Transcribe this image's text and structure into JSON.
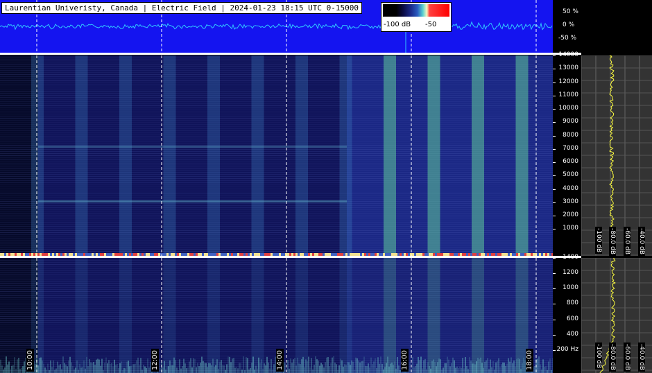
{
  "header": {
    "title": "Laurentian Univeristy, Canada | Electric Field | 2024-01-23 18:15 UTC 0-15000"
  },
  "colorbar": {
    "min_label": "-100 dB",
    "max_label": "-50"
  },
  "waveform_scale": {
    "top": "50 %",
    "mid": "0 %",
    "bottom": "-50 %"
  },
  "upper_freq_axis": {
    "ticks": [
      "14000",
      "13000",
      "12000",
      "11000",
      "10000",
      "9000",
      "8000",
      "7000",
      "6000",
      "5000",
      "4000",
      "3000",
      "2000",
      "1000"
    ]
  },
  "lower_freq_axis": {
    "ticks": [
      "1400",
      "1200",
      "1000",
      "800",
      "600",
      "400",
      "200 Hz"
    ]
  },
  "side_db_labels": [
    "-100 dB",
    "-80.0 dB",
    "-60.0 dB",
    "-40.0 dB"
  ],
  "time_labels": [
    "10:00",
    "12:00",
    "14:00",
    "16:00",
    "18:00"
  ],
  "colors": {
    "waveform_bg": "#1414f0",
    "waveform_trace": "#30c8ff",
    "spectrum_bg": "#10145a",
    "band_bright": "#5fc89a",
    "side_trace": "#ffff40"
  },
  "icons": [
    "colorbar-gradient"
  ]
}
